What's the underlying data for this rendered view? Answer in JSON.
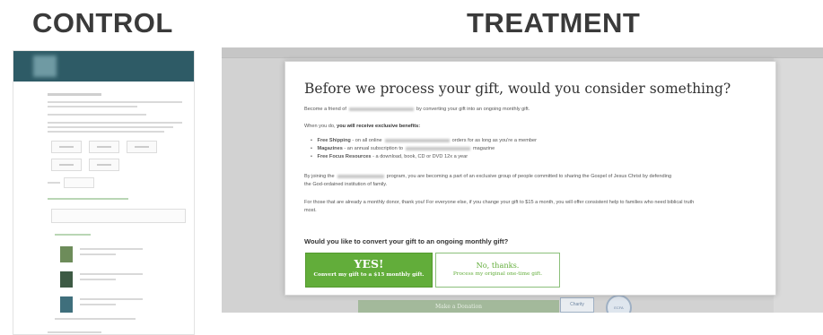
{
  "labels": {
    "control": "CONTROL",
    "treatment": "TREATMENT"
  },
  "treatment": {
    "modal": {
      "title": "Before we process your gift, would you consider something?",
      "intro_prefix": "Become a friend of",
      "intro_suffix": "by converting your gift into an ongoing monthly gift.",
      "benefits_prefix": "When you do,",
      "benefits_bold": "you will receive exclusive benefits:",
      "bullets": [
        {
          "bold": "Free Shipping",
          "text_a": "- on all online",
          "text_b": "orders for as long as you're a member"
        },
        {
          "bold": "Magazines",
          "text_a": "- an annual subscription to",
          "text_b": "magazine"
        },
        {
          "bold": "Free Focus Resources",
          "text_a": "- a download, book, CD or DVD 12x a year",
          "text_b": ""
        }
      ],
      "program_prefix": "By joining the",
      "program_suffix": "program, you are becoming a part of an exclusive group of people committed to sharing the Gospel of Jesus Christ by defending",
      "program_line2": "the God-ordained institution of family.",
      "donors_line1": "For those that are already a monthly donor, thank you! For everyone else, if you change your gift to $15 a month, you will offer consistent help to families who need biblical truth",
      "donors_line2": "most.",
      "question": "Would you like to convert your gift to an ongoing monthly gift?",
      "yes_title": "YES!",
      "yes_subtitle": "Convert my gift to a $15 monthly gift.",
      "no_title": "No, thanks.",
      "no_subtitle": "Process my original one-time gift."
    },
    "background": {
      "donate_button": "Make a Donation",
      "badge1": "Charity Navigator",
      "badge2": "ECFA"
    }
  },
  "colors": {
    "heading": "#3a3a3a",
    "control_header": "#2e5b66",
    "yes_button": "#62ad3a",
    "no_button_border": "#8cc07b"
  }
}
